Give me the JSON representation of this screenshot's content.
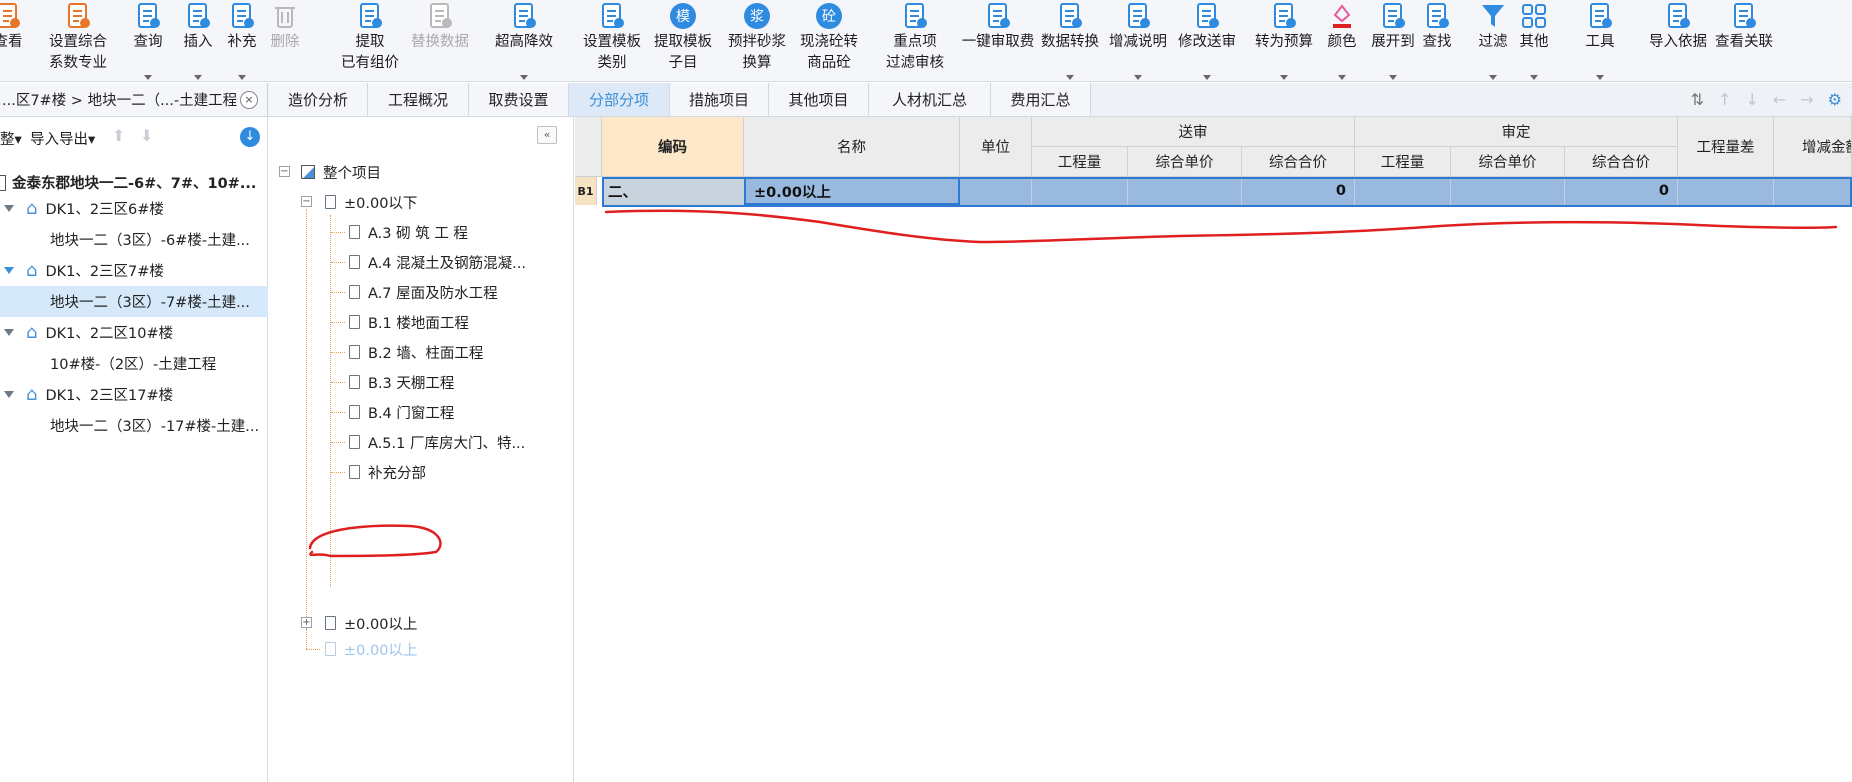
{
  "toolbar": {
    "items": [
      {
        "label": "查看",
        "icon": "view-icon"
      },
      {
        "label": "设置综合\n系数专业",
        "icon": "settings-coefficient-icon"
      },
      {
        "label": "查询",
        "icon": "query-icon"
      },
      {
        "label": "插入",
        "icon": "insert-icon"
      },
      {
        "label": "补充",
        "icon": "supplement-icon"
      },
      {
        "label": "删除",
        "icon": "delete-icon"
      },
      {
        "label": "提取\n已有组价",
        "icon": "extract-icon"
      },
      {
        "label": "替换数据",
        "icon": "replace-icon"
      },
      {
        "label": "超高降效",
        "icon": "high-efficiency-icon"
      },
      {
        "label": "设置模板\n类别",
        "icon": "template-category-icon"
      },
      {
        "label": "提取模板\n子目",
        "icon": "extract-template-icon"
      },
      {
        "label": "预拌砂浆\n换算",
        "icon": "mortar-convert-icon"
      },
      {
        "label": "现浇砼转\n商品砼",
        "icon": "concrete-convert-icon"
      },
      {
        "label": "重点项\n过滤审核",
        "icon": "filter-review-icon"
      },
      {
        "label": "一键审取费",
        "icon": "one-click-review-icon"
      },
      {
        "label": "数据转换",
        "icon": "data-convert-icon"
      },
      {
        "label": "增减说明",
        "icon": "change-note-icon"
      },
      {
        "label": "修改送审",
        "icon": "edit-submit-icon"
      },
      {
        "label": "转为预算",
        "icon": "to-budget-icon"
      },
      {
        "label": "颜色",
        "icon": "color-icon"
      },
      {
        "label": "展开到",
        "icon": "expand-to-icon"
      },
      {
        "label": "查找",
        "icon": "find-icon"
      },
      {
        "label": "过滤",
        "icon": "filter-icon"
      },
      {
        "label": "其他",
        "icon": "other-icon"
      },
      {
        "label": "工具",
        "icon": "tools-icon"
      },
      {
        "label": "导入依据",
        "icon": "import-basis-icon"
      },
      {
        "label": "查看关联",
        "icon": "view-link-icon"
      }
    ]
  },
  "breadcrumb": "...区7#楼 > 地块一二（...-土建工程",
  "tabs": [
    {
      "label": "造价分析",
      "active": false
    },
    {
      "label": "工程概况",
      "active": false
    },
    {
      "label": "取费设置",
      "active": false
    },
    {
      "label": "分部分项",
      "active": true
    },
    {
      "label": "措施项目",
      "active": false
    },
    {
      "label": "其他项目",
      "active": false
    },
    {
      "label": "人材机汇总",
      "active": false
    },
    {
      "label": "费用汇总",
      "active": false
    }
  ],
  "left_panel": {
    "toolbar": {
      "btn1": "整▾",
      "btn2": "导入导出▾"
    },
    "root": "金泰东郡地块一二-6#、7#、10#...",
    "items": [
      {
        "label": "DK1、2三区6#楼",
        "level": 1
      },
      {
        "label": "地块一二（3区）-6#楼-土建...",
        "level": 2,
        "selected": false
      },
      {
        "label": "DK1、2三区7#楼",
        "level": 1
      },
      {
        "label": "地块一二（3区）-7#楼-土建...",
        "level": 2,
        "selected": true
      },
      {
        "label": "DK1、2二区10#楼",
        "level": 1
      },
      {
        "label": "10#楼-（2区）-土建工程",
        "level": 2,
        "selected": false
      },
      {
        "label": "DK1、2三区17#楼",
        "level": 1
      },
      {
        "label": "地块一二（3区）-17#楼-土建...",
        "level": 2,
        "selected": false
      }
    ]
  },
  "tree": {
    "root": "整个项目",
    "group1": "±0.00以下",
    "children": [
      "A.3  砌 筑 工 程",
      "A.4  混凝土及钢筋混凝...",
      "A.7  屋面及防水工程",
      "B.1  楼地面工程",
      "B.2  墙、柱面工程",
      "B.3  天棚工程",
      "B.4  门窗工程",
      "A.5.1  厂库房大门、特...",
      "补充分部"
    ],
    "group2": "±0.00以上",
    "group3": "±0.00以上"
  },
  "grid": {
    "headers": {
      "code": "编码",
      "name": "名称",
      "unit": "单位",
      "submitted": "送审",
      "approved": "审定",
      "qty": "工程量",
      "unit_price": "综合单价",
      "total_price": "综合合价",
      "qty_diff": "工程量差",
      "increase": "增减金额"
    },
    "rows": [
      {
        "row_id": "B1",
        "code": "二、",
        "name": "±0.00以上",
        "unit": "",
        "sub_qty": "",
        "sub_price": "",
        "sub_total": "0",
        "app_qty": "",
        "app_price": "",
        "app_total": "0",
        "qty_diff": "",
        "increase": ""
      }
    ]
  },
  "colors": {
    "accent": "#3b8fd8",
    "selected_row": "#99b9de",
    "code_header": "#fde9c9",
    "annotation": "#e02020"
  }
}
